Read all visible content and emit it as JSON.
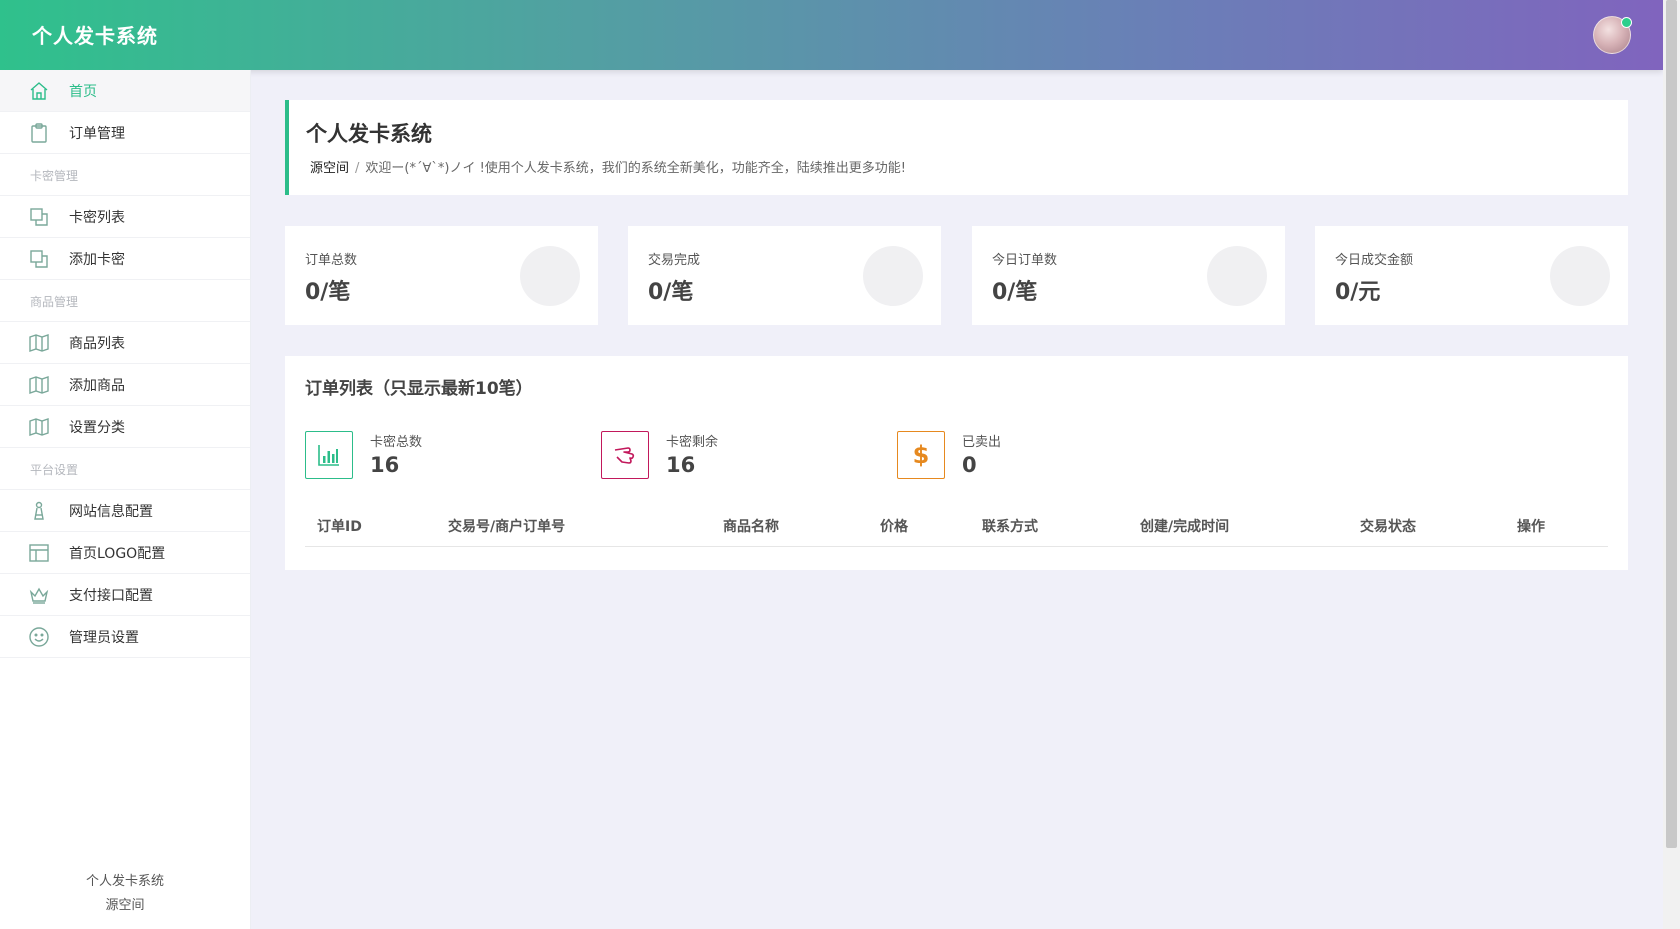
{
  "header": {
    "app_title": "个人发卡系统"
  },
  "sidebar": {
    "items": [
      {
        "label": "首页"
      },
      {
        "label": "订单管理"
      },
      {
        "group": "卡密管理"
      },
      {
        "label": "卡密列表"
      },
      {
        "label": "添加卡密"
      },
      {
        "group": "商品管理"
      },
      {
        "label": "商品列表"
      },
      {
        "label": "添加商品"
      },
      {
        "label": "设置分类"
      },
      {
        "group": "平台设置"
      },
      {
        "label": "网站信息配置"
      },
      {
        "label": "首页LOGO配置"
      },
      {
        "label": "支付接口配置"
      },
      {
        "label": "管理员设置"
      }
    ],
    "footer_line1": "个人发卡系统",
    "footer_line2": "源空间"
  },
  "welcome": {
    "title": "个人发卡系统",
    "breadcrumb_home": "源空间",
    "breadcrumb_sep": "/",
    "message": "欢迎ー(*´∀`*)ノイ !使用个人发卡系统，我们的系统全新美化，功能齐全，陆续推出更多功能!"
  },
  "stats": [
    {
      "label": "订单总数",
      "value": "0/笔"
    },
    {
      "label": "交易完成",
      "value": "0/笔"
    },
    {
      "label": "今日订单数",
      "value": "0/笔"
    },
    {
      "label": "今日成交金额",
      "value": "0/元"
    }
  ],
  "orders": {
    "title": "订单列表（只显示最新10笔）",
    "metrics": [
      {
        "label": "卡密总数",
        "value": "16",
        "color": "#2cbd8a",
        "icon": "bar-chart-icon"
      },
      {
        "label": "卡密剩余",
        "value": "16",
        "color": "#c2185b",
        "icon": "hand-icon"
      },
      {
        "label": "已卖出",
        "value": "0",
        "color": "#e6891f",
        "icon": "dollar-icon"
      }
    ],
    "columns": [
      "订单ID",
      "交易号/商户订单号",
      "商品名称",
      "价格",
      "联系方式",
      "创建/完成时间",
      "交易状态",
      "操作"
    ]
  },
  "colors": {
    "accent": "#2cbd8a",
    "header_start": "#2fc18c",
    "header_end": "#8064be"
  }
}
